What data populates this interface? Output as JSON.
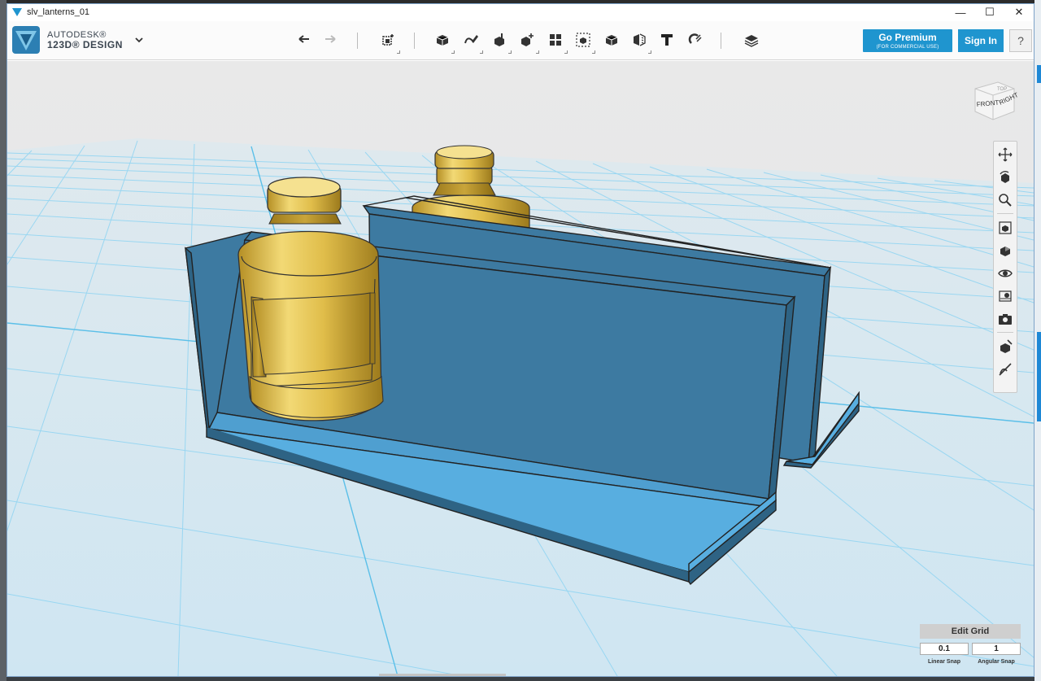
{
  "window": {
    "title": "slv_lanterns_01",
    "controls": {
      "minimize": "—",
      "maximize": "☐",
      "close": "✕"
    }
  },
  "brand": {
    "line1": "AUTODESK®",
    "line2": "123D® DESIGN"
  },
  "toolbar": {
    "tools": [
      {
        "id": "undo",
        "icon": "undo-icon"
      },
      {
        "id": "redo",
        "icon": "redo-icon"
      },
      {
        "id": "transform",
        "icon": "transform-icon"
      },
      {
        "id": "primitives",
        "icon": "primitives-cube-icon"
      },
      {
        "id": "sketch",
        "icon": "sketch-icon"
      },
      {
        "id": "construct",
        "icon": "construct-icon"
      },
      {
        "id": "modify",
        "icon": "modify-icon"
      },
      {
        "id": "pattern",
        "icon": "pattern-icon"
      },
      {
        "id": "group",
        "icon": "group-icon"
      },
      {
        "id": "combine",
        "icon": "combine-icon"
      },
      {
        "id": "measure",
        "icon": "measure-icon"
      },
      {
        "id": "text",
        "icon": "text-icon"
      },
      {
        "id": "snap",
        "icon": "snap-icon"
      },
      {
        "id": "material",
        "icon": "material-layers-icon"
      }
    ],
    "premium_label": "Go Premium",
    "premium_sub": "(FOR COMMERCIAL USE)",
    "signin_label": "Sign In",
    "help_label": "?"
  },
  "viewcube": {
    "front": "FRONT",
    "right": "RIGHT",
    "top": "TOP"
  },
  "nav_tools": [
    "pan-icon",
    "orbit-icon",
    "zoom-icon",
    "fit-icon",
    "view-icon",
    "visibility-icon",
    "material-view-icon",
    "camera-icon",
    "snap-view-icon",
    "hide-sketch-icon"
  ],
  "grid": {
    "edit_label": "Edit Grid",
    "linear_value": "0.1",
    "angular_value": "1",
    "linear_label": "Linear Snap",
    "angular_label": "Angular Snap"
  },
  "colors": {
    "accent": "#1f95cf",
    "part_blue": "#3d7aa1",
    "part_light": "#58aee0",
    "gold": "#e0bd4a",
    "grid_line": "#7ccff0"
  }
}
